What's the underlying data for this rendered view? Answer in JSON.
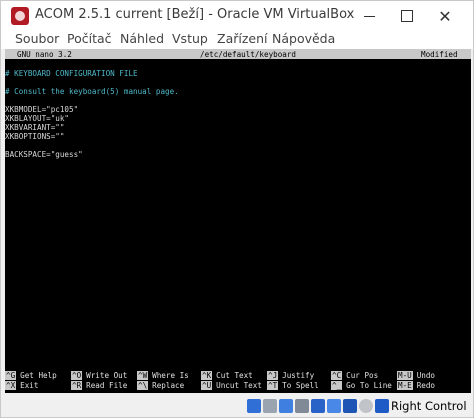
{
  "window": {
    "title": "ACOM 2.5.1 current [Beží] - Oracle VM VirtualBox",
    "controls": {
      "minimize": "",
      "maximize": "",
      "close": "✕"
    }
  },
  "menu": [
    "Soubor",
    "Počítač",
    "Náhled",
    "Vstup",
    "Zařízení",
    "Nápověda"
  ],
  "nano": {
    "version": "GNU nano 3.2",
    "filename": "/etc/default/keyboard",
    "status": "Modified",
    "lines": [
      "# KEYBOARD CONFIGURATION FILE",
      "",
      "# Consult the keyboard(5) manual page.",
      "",
      "XKBMODEL=\"pc105\"",
      "XKBLAYOUT=\"uk\"",
      "XKBVARIANT=\"\"",
      "XKBOPTIONS=\"\"",
      "",
      "BACKSPACE=\"guess\""
    ],
    "shortcuts_row1": [
      {
        "key": "^G",
        "label": "Get Help"
      },
      {
        "key": "^O",
        "label": "Write Out"
      },
      {
        "key": "^W",
        "label": "Where Is"
      },
      {
        "key": "^K",
        "label": "Cut Text"
      },
      {
        "key": "^J",
        "label": "Justify"
      },
      {
        "key": "^C",
        "label": "Cur Pos"
      },
      {
        "key": "M-U",
        "label": "Undo"
      }
    ],
    "shortcuts_row2": [
      {
        "key": "^X",
        "label": "Exit"
      },
      {
        "key": "^R",
        "label": "Read File"
      },
      {
        "key": "^\\",
        "label": "Replace"
      },
      {
        "key": "^U",
        "label": "Uncut Text"
      },
      {
        "key": "^T",
        "label": "To Spell"
      },
      {
        "key": "^_",
        "label": "Go To Line"
      },
      {
        "key": "M-E",
        "label": "Redo"
      }
    ]
  },
  "statusbar": {
    "icons": [
      "hard-disk-icon",
      "optical-drive-icon",
      "audio-icon",
      "network-icon",
      "usb-icon",
      "shared-folders-icon",
      "display-icon",
      "video-capture-icon",
      "mouse-integration-icon",
      "keyboard-icon"
    ],
    "host_key_label": "Right Control",
    "colors": {
      "accent": "#1e5bc6",
      "title_icon": "#b31b24",
      "comment": "#4fb8c9"
    }
  }
}
